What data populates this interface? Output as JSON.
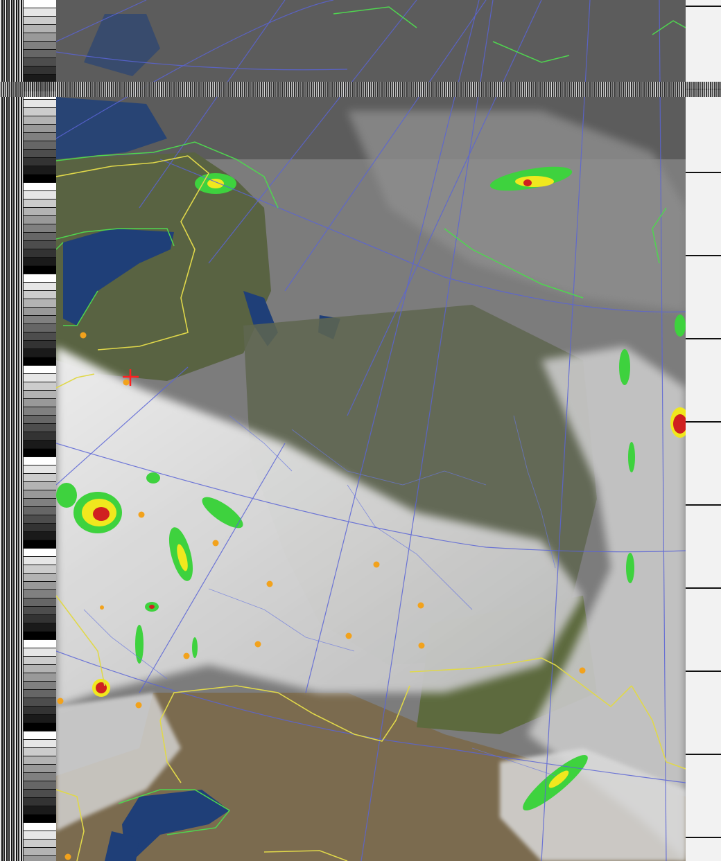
{
  "image": {
    "kind": "NOAA APT satellite image (false-color composite with map overlay)",
    "colors": {
      "sea": "#1f3f78",
      "land_green": "#5d6a3e",
      "land_brown": "#7b6b4f",
      "cloud_light": "#e3e3e3",
      "cloud_mid": "#a2a2a2",
      "cloud_dark": "#5a5a5a",
      "grid_line": "#5a64d6",
      "coastline": "#4fd64f",
      "border": "#e0d84a",
      "city_marker": "#f2a21c",
      "station_marker": "#ff2020",
      "precip_green": "#3ed23e",
      "precip_yellow": "#f0e81e",
      "precip_red": "#d02020"
    }
  },
  "markers": {
    "station_symbol": "+",
    "city_count": 20
  }
}
